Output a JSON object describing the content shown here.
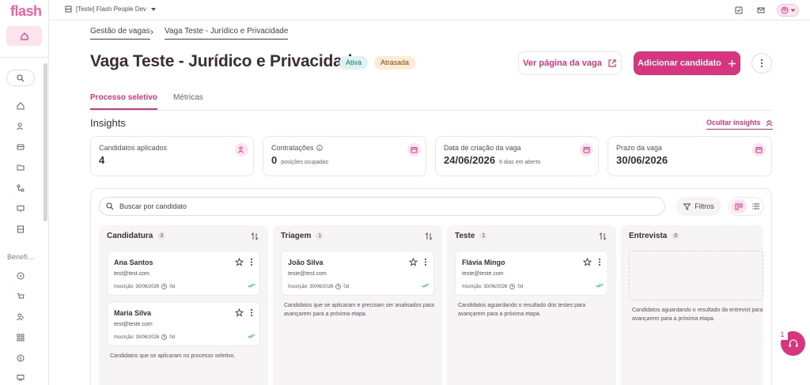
{
  "brand": {
    "logo_text": "flash",
    "accent": "#d9357e",
    "accent_light": "#fde3ee"
  },
  "topbar": {
    "company": "[Teste] Flash People Dev"
  },
  "sidebar": {
    "section_label": "Benefí...",
    "icons": [
      "home-icon",
      "users-icon",
      "wallet-icon",
      "folder-icon",
      "workflow-icon",
      "monitor-icon",
      "building-icon",
      "circle-dollar-icon",
      "cart-icon",
      "user-add-icon",
      "grid-icon",
      "coin-icon",
      "presentation-icon"
    ]
  },
  "breadcrumb": {
    "first": "Gestão de vagas",
    "second": "Vaga Teste - Jurídico e Privacidade"
  },
  "header": {
    "title": "Vaga Teste - Jurídico e Privacidade",
    "badge_active": "Ativa",
    "badge_late": "Atrasada",
    "view_page_label": "Ver página da vaga",
    "add_candidate_label": "Adicionar candidato"
  },
  "tabs": [
    {
      "label": "Processo seletivo"
    },
    {
      "label": "Métricas"
    }
  ],
  "insights": {
    "title": "Insights",
    "hide_label": "Ocultar insights",
    "cards": [
      {
        "label": "Candidatos aplicados",
        "value": "4",
        "sub": ""
      },
      {
        "label": "Contratações",
        "value": "0",
        "sub": "posições ocupadas"
      },
      {
        "label": "Data de criação da vaga",
        "value": "24/06/2026",
        "sub": "6 dias em aberto"
      },
      {
        "label": "Prazo da vaga",
        "value": "30/06/2026",
        "sub": ""
      }
    ]
  },
  "board": {
    "search_placeholder": "Buscar por candidato",
    "filters_label": "Filtros",
    "columns": [
      {
        "name": "Candidatura",
        "count": "3",
        "candidates": [
          {
            "name": "Ana Santos",
            "email": "test@test.com",
            "meta": "Inscrição: 30/06/2026",
            "days": "0d"
          },
          {
            "name": "Maria Silva",
            "email": "test@teste.com",
            "meta": "Inscrição: 30/06/2026",
            "days": "0d"
          }
        ],
        "description": "Candidatos que se aplicaram no processo seletivo."
      },
      {
        "name": "Triagem",
        "count": "1",
        "candidates": [
          {
            "name": "João Silva",
            "email": "teste@test.com",
            "meta": "Inscrição: 30/06/2026",
            "days": "0d"
          }
        ],
        "description": "Candidatos que se aplicaram e precisam ser analisados para avançarem para a próxima etapa."
      },
      {
        "name": "Teste",
        "count": "1",
        "candidates": [
          {
            "name": "Flávia Mingo",
            "email": "teste@teste.com",
            "meta": "Inscrição: 30/06/2026",
            "days": "0d"
          }
        ],
        "description": "Candidatos aguardando o resultado dos testes para avançarem para a próxima etapa."
      },
      {
        "name": "Entrevista",
        "count": "0",
        "candidates": [],
        "description": "Candidatos aguardando o resultado da entrevist para avançarem para a próxima etapa."
      }
    ]
  },
  "help": {
    "badge": "1"
  }
}
